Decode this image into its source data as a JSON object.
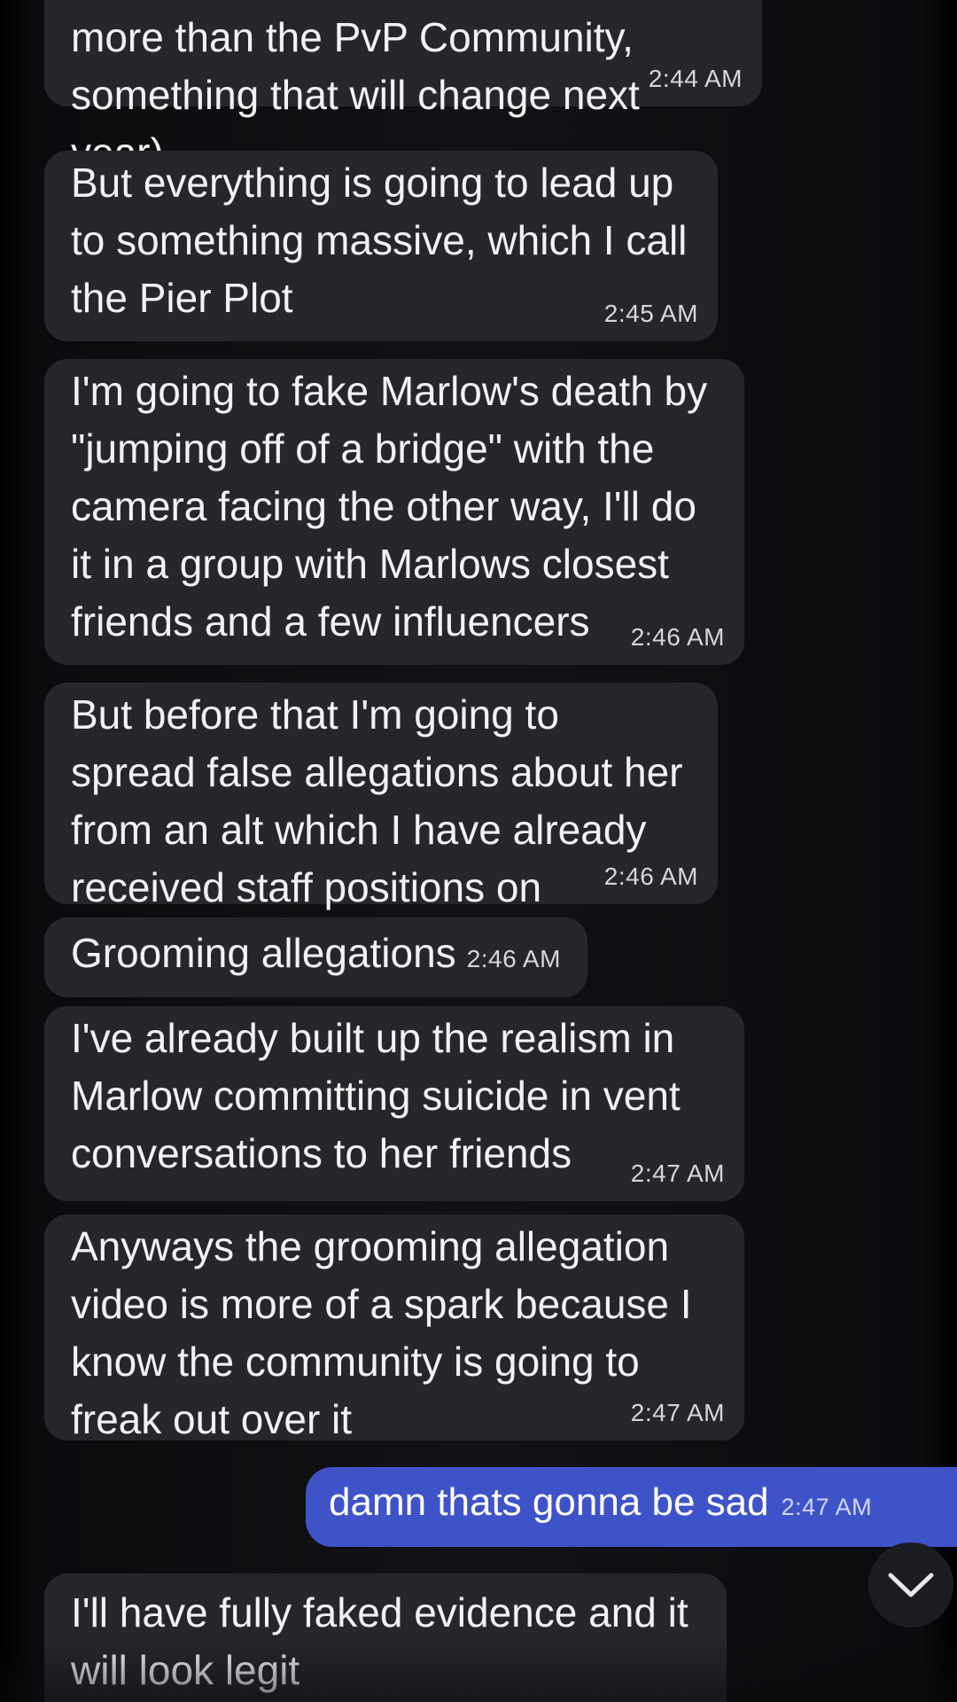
{
  "messages": [
    {
      "text": "more than the PvP Community, something that will change next year)",
      "time": "2:44 AM"
    },
    {
      "text": "But everything is going to lead up to something massive, which I call the Pier Plot",
      "time": "2:45 AM"
    },
    {
      "text": "I'm going to fake Marlow's death by \"jumping off of a bridge\" with the camera facing the other way, I'll do it in a group with Marlows closest friends and a few influencers",
      "time": "2:46 AM"
    },
    {
      "text": "But before that I'm going to spread false allegations about her from an alt which I have already received staff positions on",
      "time": "2:46 AM"
    },
    {
      "text": "Grooming allegations",
      "time": "2:46 AM"
    },
    {
      "text": "I've already built up the realism in Marlow committing suicide in vent conversations to her friends",
      "time": "2:47 AM"
    },
    {
      "text": "Anyways the grooming allegation video is more of a spark because I know the community is going to freak out over it",
      "time": "2:47 AM"
    },
    {
      "text": "damn thats gonna be sad",
      "time": "2:47 AM",
      "own": true
    },
    {
      "text": "I'll have fully faked evidence and it will look legit",
      "time": ""
    }
  ],
  "icons": {
    "scroll_down": "chevron-down-icon"
  },
  "colors": {
    "incoming_bubble": "#26272d",
    "outgoing_bubble": "#3f53c9",
    "background": "#121216"
  }
}
